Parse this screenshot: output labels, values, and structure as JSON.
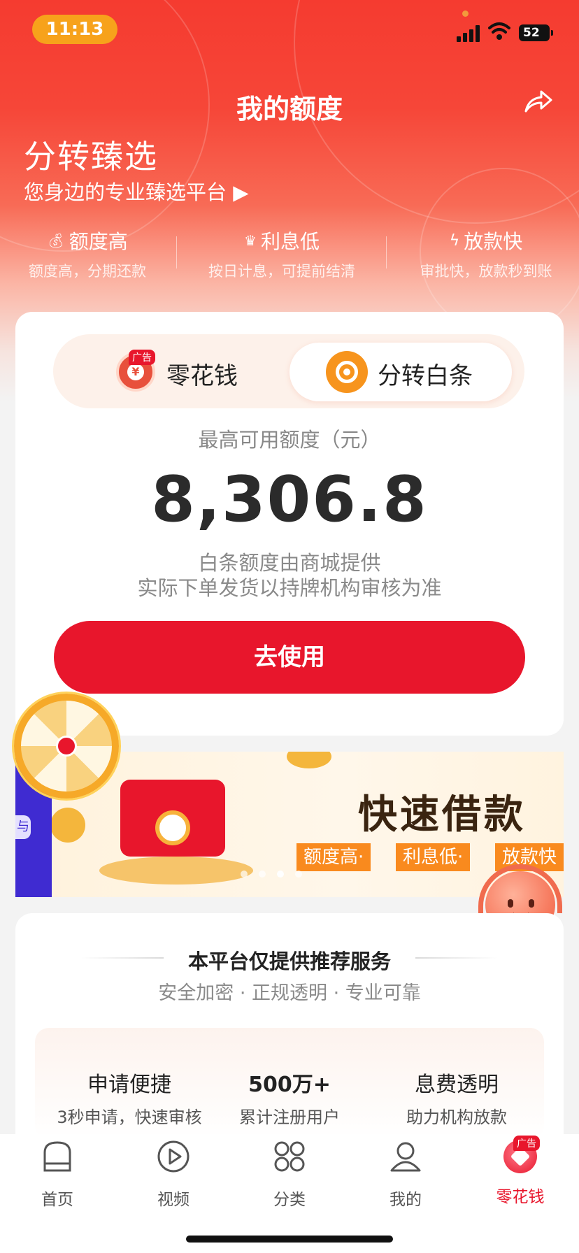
{
  "status": {
    "time": "11:13",
    "battery": "52"
  },
  "header": {
    "title": "我的额度"
  },
  "hero": {
    "brand": "分转臻选",
    "slogan": "您身边的专业臻选平台 ▶",
    "features": [
      {
        "title": "额度高",
        "desc": "额度高，分期还款",
        "icon": "money-bag-icon"
      },
      {
        "title": "利息低",
        "desc": "按日计息，可提前结清",
        "icon": "crown-icon"
      },
      {
        "title": "放款快",
        "desc": "审批快，放款秒到账",
        "icon": "lightning-icon"
      }
    ]
  },
  "card": {
    "tabs": [
      {
        "label": "零花钱",
        "badge": "广告",
        "coin": "¥"
      },
      {
        "label": "分转白条",
        "active": true
      }
    ],
    "amount_label": "最高可用额度（元）",
    "amount": "8,306.8",
    "note1": "白条额度由商城提供",
    "note2": "实际下单发货以持牌机构审核为准",
    "cta": "去使用"
  },
  "banner": {
    "side_tab": "与",
    "title": "快速借款",
    "chips": [
      "额度高·",
      "利息低·",
      "放款快"
    ]
  },
  "service": {
    "title": "本平台仅提供推荐服务",
    "subtitle": "安全加密  ·  正规透明  ·  专业可靠",
    "stats": [
      {
        "title": "申请便捷",
        "desc": "3秒申请，快速审核"
      },
      {
        "title": "500万+",
        "desc": "累计注册用户"
      },
      {
        "title": "息费透明",
        "desc": "助力机构放款"
      }
    ]
  },
  "tabbar": {
    "items": [
      {
        "label": "首页",
        "icon": "home-icon"
      },
      {
        "label": "视频",
        "icon": "video-play-icon"
      },
      {
        "label": "分类",
        "icon": "category-grid-icon"
      },
      {
        "label": "我的",
        "icon": "user-icon"
      },
      {
        "label": "零花钱",
        "icon": "pocket-money-icon",
        "active": true,
        "badge": "广告"
      }
    ]
  },
  "colors": {
    "accent": "#e8162c",
    "header": "#f53b30",
    "chip": "#f98a1e"
  }
}
